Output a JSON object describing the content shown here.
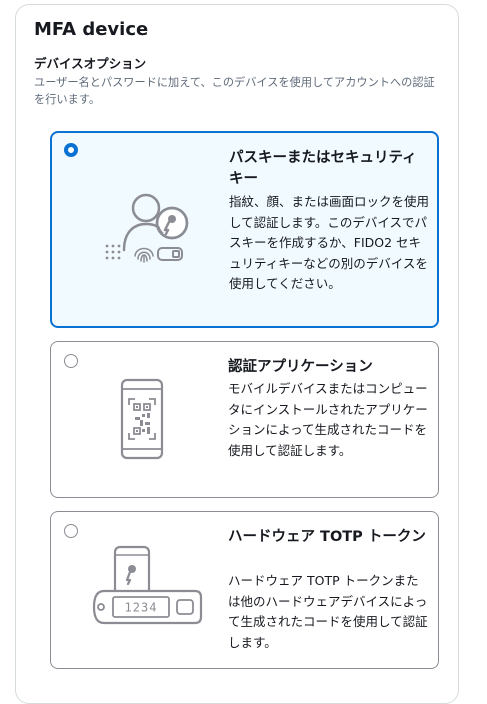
{
  "panel": {
    "title": "MFA device",
    "section_label": "デバイスオプション",
    "section_description": "ユーザー名とパスワードに加えて、このデバイスを使用してアカウントへの認証を行います。"
  },
  "options": [
    {
      "title": "パスキーまたはセキュリティキー",
      "description": "指紋、顔、または画面ロックを使用して認証します。このデバイスでパスキーを作成するか、FIDO2 セキュリティキーなどの別のデバイスを使用してください。",
      "selected": true,
      "icon": "passkey-icon"
    },
    {
      "title": "認証アプリケーション",
      "description": "モバイルデバイスまたはコンピュータにインストールされたアプリケーションによって生成されたコードを使用して認証します。",
      "selected": false,
      "icon": "authenticator-app-icon"
    },
    {
      "title": "ハードウェア TOTP トークン",
      "description": "ハードウェア TOTP トークンまたは他のハードウェアデバイスによって生成されたコードを使用して認証します。",
      "selected": false,
      "icon": "hardware-token-icon",
      "token_digits": "1234"
    }
  ],
  "colors": {
    "accent": "#0972d3",
    "selected_bg": "#f1faff",
    "icon_gray": "#8c8c94"
  }
}
